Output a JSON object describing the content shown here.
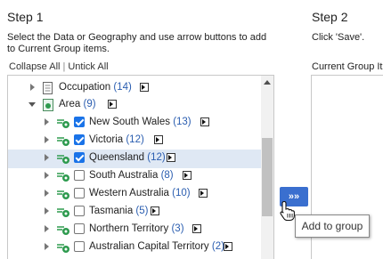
{
  "step1": {
    "title": "Step 1",
    "instructions_line1": "Select the Data or Geography and use arrow buttons to add",
    "instructions_line2": "to Current Group items.",
    "collapse_all": "Collapse All",
    "separator": "|",
    "untick_all": "Untick All"
  },
  "step2": {
    "title": "Step 2",
    "instructions": "Click 'Save'.",
    "current_group_label": "Current Group It"
  },
  "tree": {
    "occupation": {
      "label": "Occupation",
      "count": "(14)"
    },
    "area": {
      "label": "Area",
      "count": "(9)"
    },
    "items": [
      {
        "label": "New South Wales",
        "count": "(13)",
        "checked": true
      },
      {
        "label": "Victoria",
        "count": "(12)",
        "checked": true
      },
      {
        "label": "Queensland",
        "count": "(12)",
        "checked": true,
        "selected": true
      },
      {
        "label": "South Australia",
        "count": "(8)",
        "checked": false
      },
      {
        "label": "Western Australia",
        "count": "(10)",
        "checked": false
      },
      {
        "label": "Tasmania",
        "count": "(5)",
        "checked": false
      },
      {
        "label": "Northern Territory",
        "count": "(3)",
        "checked": false
      },
      {
        "label": "Australian Capital Territory",
        "count": "(2)",
        "checked": false
      }
    ]
  },
  "move_button": {
    "label": "»»"
  },
  "tooltip": {
    "text": "Add to group"
  },
  "colors": {
    "accent": "#3a6fcf",
    "count_text": "#2a5db0",
    "selected_row": "#dfe8f4",
    "checkbox_on": "#1a73e8"
  }
}
